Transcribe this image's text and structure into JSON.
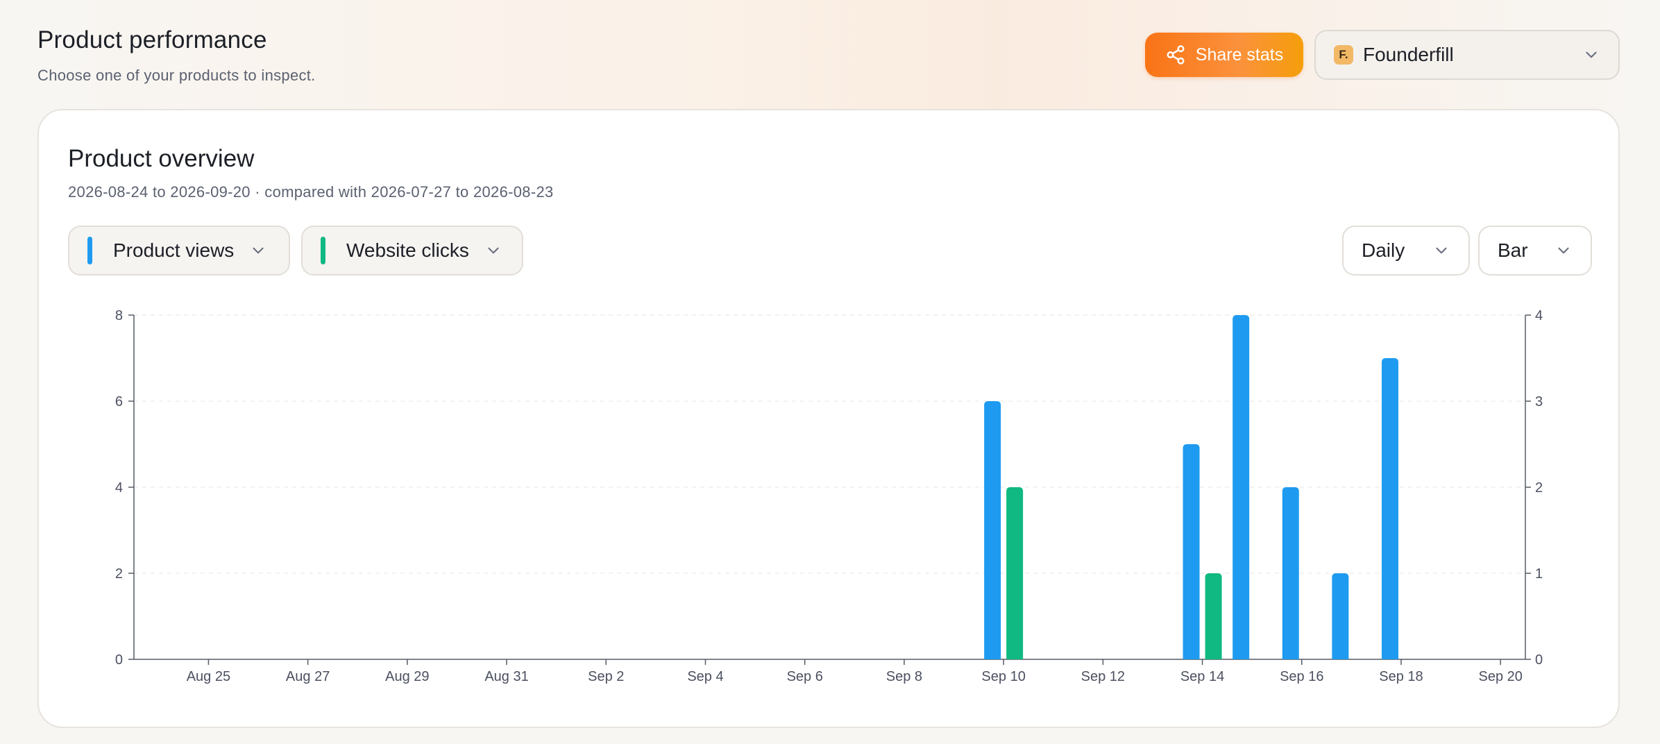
{
  "header": {
    "title": "Product performance",
    "subtitle": "Choose one of your products to inspect."
  },
  "actions": {
    "share_label": "Share stats",
    "product_logo_letter": "F.",
    "product_name": "Founderfill"
  },
  "card": {
    "title": "Product overview",
    "range": "2026-08-24 to 2026-09-20 · compared with 2026-07-27 to 2026-08-23",
    "metric_selectors": [
      {
        "label": "Product views",
        "color": "#1e9bf0"
      },
      {
        "label": "Website clicks",
        "color": "#10b981"
      }
    ],
    "interval": "Daily",
    "chart_style": "Bar"
  },
  "colors": {
    "accent": "#f97316",
    "views": "#1e9bf0",
    "clicks": "#10b981"
  },
  "icons": {
    "share": "share-icon",
    "dropdown": "chevron-down-icon"
  },
  "chart_data": {
    "type": "bar",
    "x": [
      "Aug 24",
      "Aug 25",
      "Aug 26",
      "Aug 27",
      "Aug 28",
      "Aug 29",
      "Aug 30",
      "Aug 31",
      "Sep 1",
      "Sep 2",
      "Sep 3",
      "Sep 4",
      "Sep 5",
      "Sep 6",
      "Sep 7",
      "Sep 8",
      "Sep 9",
      "Sep 10",
      "Sep 11",
      "Sep 12",
      "Sep 13",
      "Sep 14",
      "Sep 15",
      "Sep 16",
      "Sep 17",
      "Sep 18",
      "Sep 19",
      "Sep 20"
    ],
    "x_tick_labels": [
      "Aug 25",
      "Aug 27",
      "Aug 29",
      "Aug 31",
      "Sep 2",
      "Sep 4",
      "Sep 6",
      "Sep 8",
      "Sep 10",
      "Sep 12",
      "Sep 14",
      "Sep 16",
      "Sep 18",
      "Sep 20"
    ],
    "series": [
      {
        "name": "Product views",
        "axis": "left",
        "color": "#1e9bf0",
        "values": [
          0,
          0,
          0,
          0,
          0,
          0,
          0,
          0,
          0,
          0,
          0,
          0,
          0,
          0,
          0,
          0,
          0,
          6,
          0,
          0,
          0,
          5,
          8,
          4,
          2,
          7,
          0,
          0
        ]
      },
      {
        "name": "Website clicks",
        "axis": "right",
        "color": "#10b981",
        "values": [
          0,
          0,
          0,
          0,
          0,
          0,
          0,
          0,
          0,
          0,
          0,
          0,
          0,
          0,
          0,
          0,
          0,
          2,
          0,
          0,
          0,
          1,
          0,
          0,
          0,
          0,
          0,
          0
        ]
      }
    ],
    "y_left": {
      "ylim": [
        0,
        8
      ],
      "ticks": [
        0,
        2,
        4,
        6,
        8
      ]
    },
    "y_right": {
      "ylim": [
        0,
        4
      ],
      "ticks": [
        0,
        1,
        2,
        3,
        4
      ]
    },
    "grid": true
  }
}
